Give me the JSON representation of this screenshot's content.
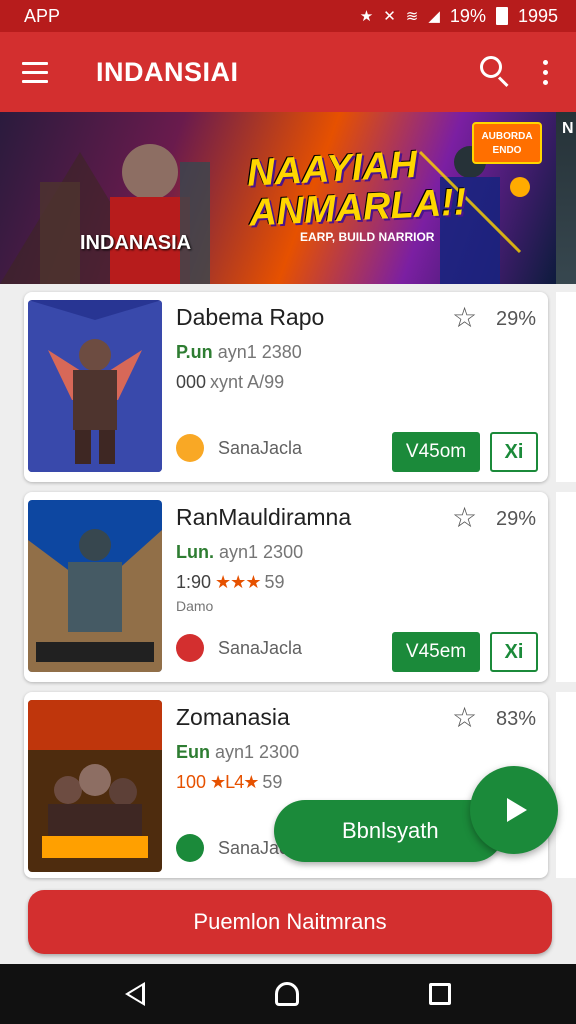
{
  "status_bar": {
    "left_text": "APP",
    "battery_pct": "19%",
    "time": "1995"
  },
  "app_bar": {
    "title": "INDANSIAI"
  },
  "banner": {
    "title_line1": "NAAYIAH",
    "title_line2": "ANMARLA!!",
    "subtitle": "EARP, BUILD NARRIOR",
    "brand": "INDANASIA",
    "tag": "AUBORDA ENDO",
    "peek_letter": "N"
  },
  "games": [
    {
      "title": "Dabema Rapo",
      "meta1_accent": "P.un",
      "meta1_rest": "ayn1 2380",
      "meta2_num": "000",
      "meta2_rest": "xynt A/99",
      "stars": "",
      "meta3": "",
      "percent": "29%",
      "developer": "SanaJacla",
      "install_label": "V45om",
      "share_label": "Xi",
      "dev_icon_color": "#f9a825"
    },
    {
      "title": "RanMauldiramna",
      "meta1_accent": "Lun.",
      "meta1_rest": "ayn1 2300",
      "meta2_num": "1:90",
      "meta2_rest": "59",
      "stars": "★★★",
      "meta3": "Damo",
      "percent": "29%",
      "developer": "SanaJacla",
      "install_label": "V45em",
      "share_label": "Xi",
      "dev_icon_color": "#d32f2f"
    },
    {
      "title": "Zomanasia",
      "meta1_accent": "Eun",
      "meta1_rest": "ayn1 2300",
      "meta2_num": "100",
      "meta2_rest": "59",
      "stars": "★L4★",
      "meta3": "",
      "percent": "83%",
      "developer": "SanaJacla",
      "install_label": "",
      "share_label": "",
      "dev_icon_color": "#1b8a3a"
    }
  ],
  "fab": {
    "label": "Bbnlsyath"
  },
  "bottom_button": {
    "label": "Puemlon Naitmrans"
  },
  "colors": {
    "primary": "#d32f2f",
    "status_bar": "#b71c1c",
    "accent_green": "#1b8a3a",
    "star_orange": "#e65100"
  },
  "icons": [
    "menu-icon",
    "search-icon",
    "more-vert-icon",
    "star-outline-icon",
    "play-icon",
    "back-icon",
    "home-icon",
    "recents-icon"
  ]
}
